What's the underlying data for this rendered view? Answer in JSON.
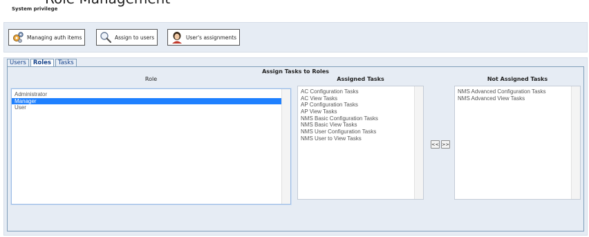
{
  "header": {
    "cropped_heading": "Role Management",
    "page_title": "System privilege"
  },
  "toolbar": {
    "buttons": [
      {
        "label": "Managing auth items",
        "icon": "gears-icon"
      },
      {
        "label": "Assign to users",
        "icon": "magnifier-icon"
      },
      {
        "label": "User's assignments",
        "icon": "user-avatar-icon"
      }
    ]
  },
  "tabs": [
    {
      "label": "Users",
      "active": false
    },
    {
      "label": "Roles",
      "active": true
    },
    {
      "label": "Tasks",
      "active": false
    }
  ],
  "assign": {
    "title": "Assign Tasks to Roles",
    "role_header": "Role",
    "assigned_header": "Assigned Tasks",
    "not_assigned_header": "Not Assigned Tasks",
    "roles": [
      "Administrator",
      "Manager",
      "User"
    ],
    "selected_role": "Manager",
    "assigned_tasks": [
      "AC Configuration Tasks",
      "AC View Tasks",
      "AP Configuration Tasks",
      "AP View Tasks",
      "NMS Basic Configuration Tasks",
      "NMS Basic View Tasks",
      "NMS User Configuration Tasks",
      "NMS User to View Tasks"
    ],
    "not_assigned_tasks": [
      "NMS Advanced Configuration Tasks",
      "NMS Advanced View Tasks"
    ],
    "move_left_label": "<<",
    "move_right_label": ">>"
  },
  "colors": {
    "selection": "#1e80ff",
    "panel_bg": "#e6ecf4",
    "tab_text": "#15428b"
  }
}
